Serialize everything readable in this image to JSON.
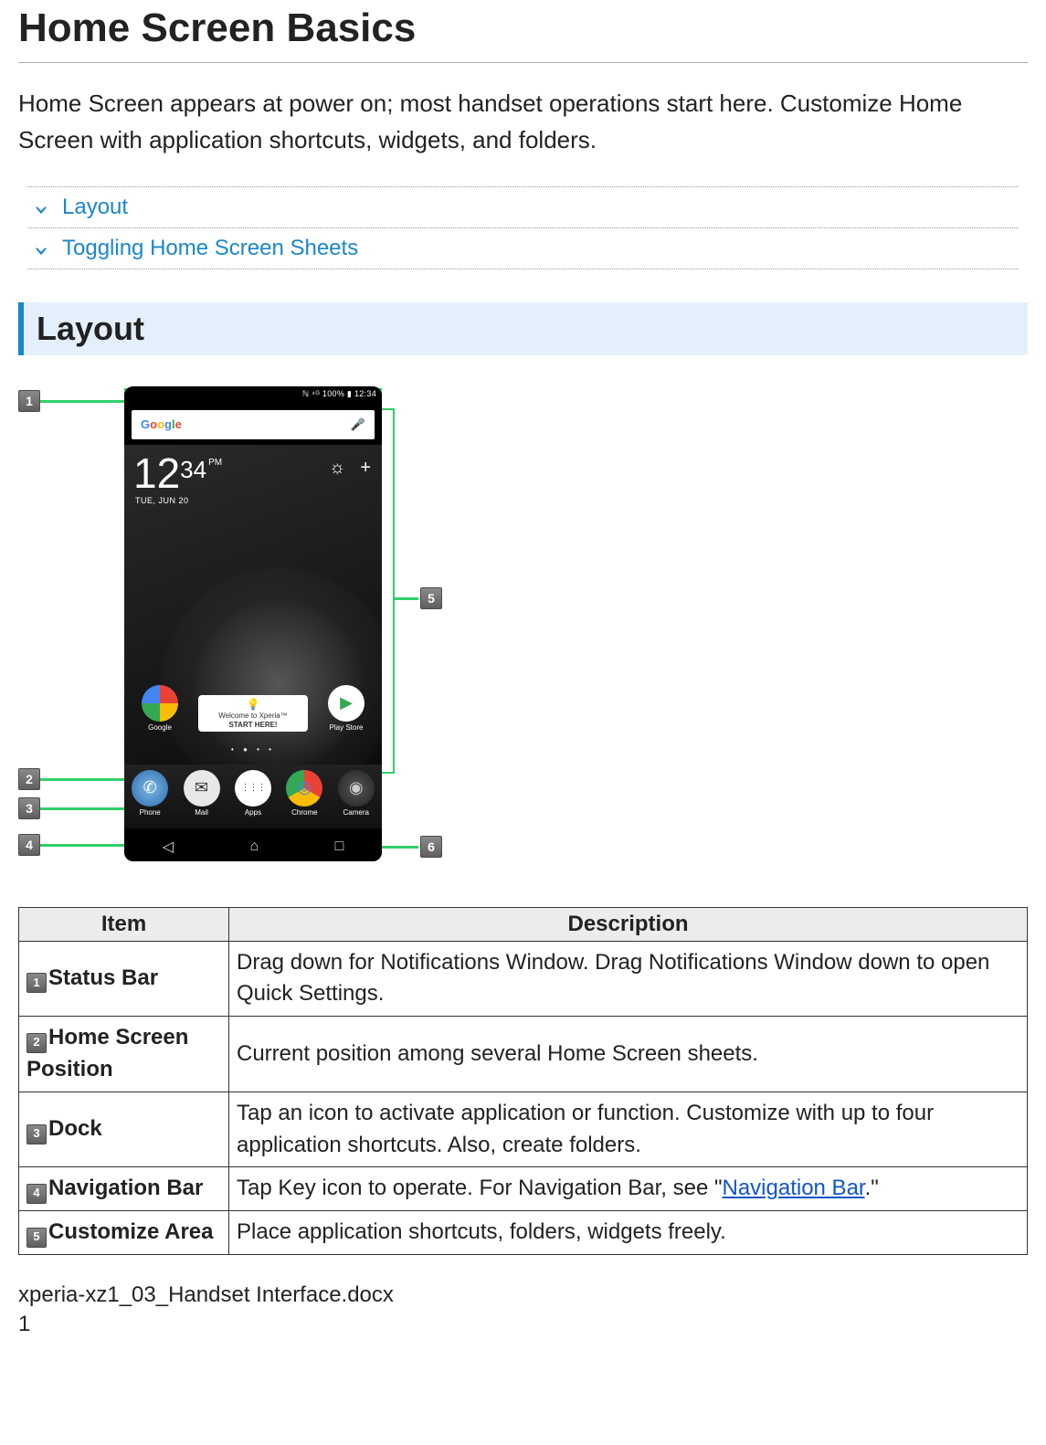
{
  "title": "Home Screen Basics",
  "intro": "Home Screen appears at power on; most handset operations start here. Customize Home Screen with application shortcuts, widgets, and folders.",
  "toc": {
    "items": [
      {
        "label": "Layout"
      },
      {
        "label": "Toggling Home Screen Sheets"
      }
    ]
  },
  "section_heading": "Layout",
  "phone": {
    "status_text": "ℕ ⁴ᴳ 100% ▮ 12:34",
    "search_brand": "Google",
    "mic_glyph": "🎤",
    "clock": {
      "hours": "12",
      "minutes": "34",
      "ampm": "PM",
      "date": "TUE, JUN 20"
    },
    "weather": {
      "icon1": "☼",
      "icon2": "+"
    },
    "row1": {
      "app1_label": "Google",
      "welcome_line1": "Welcome to Xperia™",
      "welcome_line2": "START HERE!",
      "app3_label": "Play Store",
      "play_glyph": "▶"
    },
    "dots": "• ● • •",
    "dock": {
      "items": [
        {
          "label": "Phone",
          "glyph": "✆"
        },
        {
          "label": "Mail",
          "glyph": "✉"
        },
        {
          "label": "Apps",
          "glyph": "⋮⋮⋮"
        },
        {
          "label": "Chrome",
          "glyph": "◎"
        },
        {
          "label": "Camera",
          "glyph": "◉"
        }
      ]
    },
    "nav": {
      "back": "◁",
      "home": "⌂",
      "recents": "□"
    }
  },
  "callouts": {
    "c1": "1",
    "c2": "2",
    "c3": "3",
    "c4": "4",
    "c5": "5",
    "c6": "6"
  },
  "table": {
    "headers": {
      "item": "Item",
      "description": "Description"
    },
    "rows": [
      {
        "num": "1",
        "name": "Status Bar",
        "desc": "Drag down for Notifications Window. Drag Notifications Window down to open Quick Settings."
      },
      {
        "num": "2",
        "name": "Home Screen Position",
        "desc": "Current position among several Home Screen sheets."
      },
      {
        "num": "3",
        "name": "Dock",
        "desc": "Tap an icon to activate application or function. Customize with up to four application shortcuts. Also, create folders."
      },
      {
        "num": "4",
        "name": "Navigation Bar",
        "desc_pre": "Tap Key icon to operate. For Navigation Bar, see \"",
        "link": "Navigation Bar",
        "desc_post": ".\""
      },
      {
        "num": "5",
        "name": "Customize Area",
        "desc": "Place application shortcuts, folders, widgets freely."
      }
    ]
  },
  "footer": {
    "filename": "xperia-xz1_03_Handset Interface.docx",
    "page": "1"
  }
}
